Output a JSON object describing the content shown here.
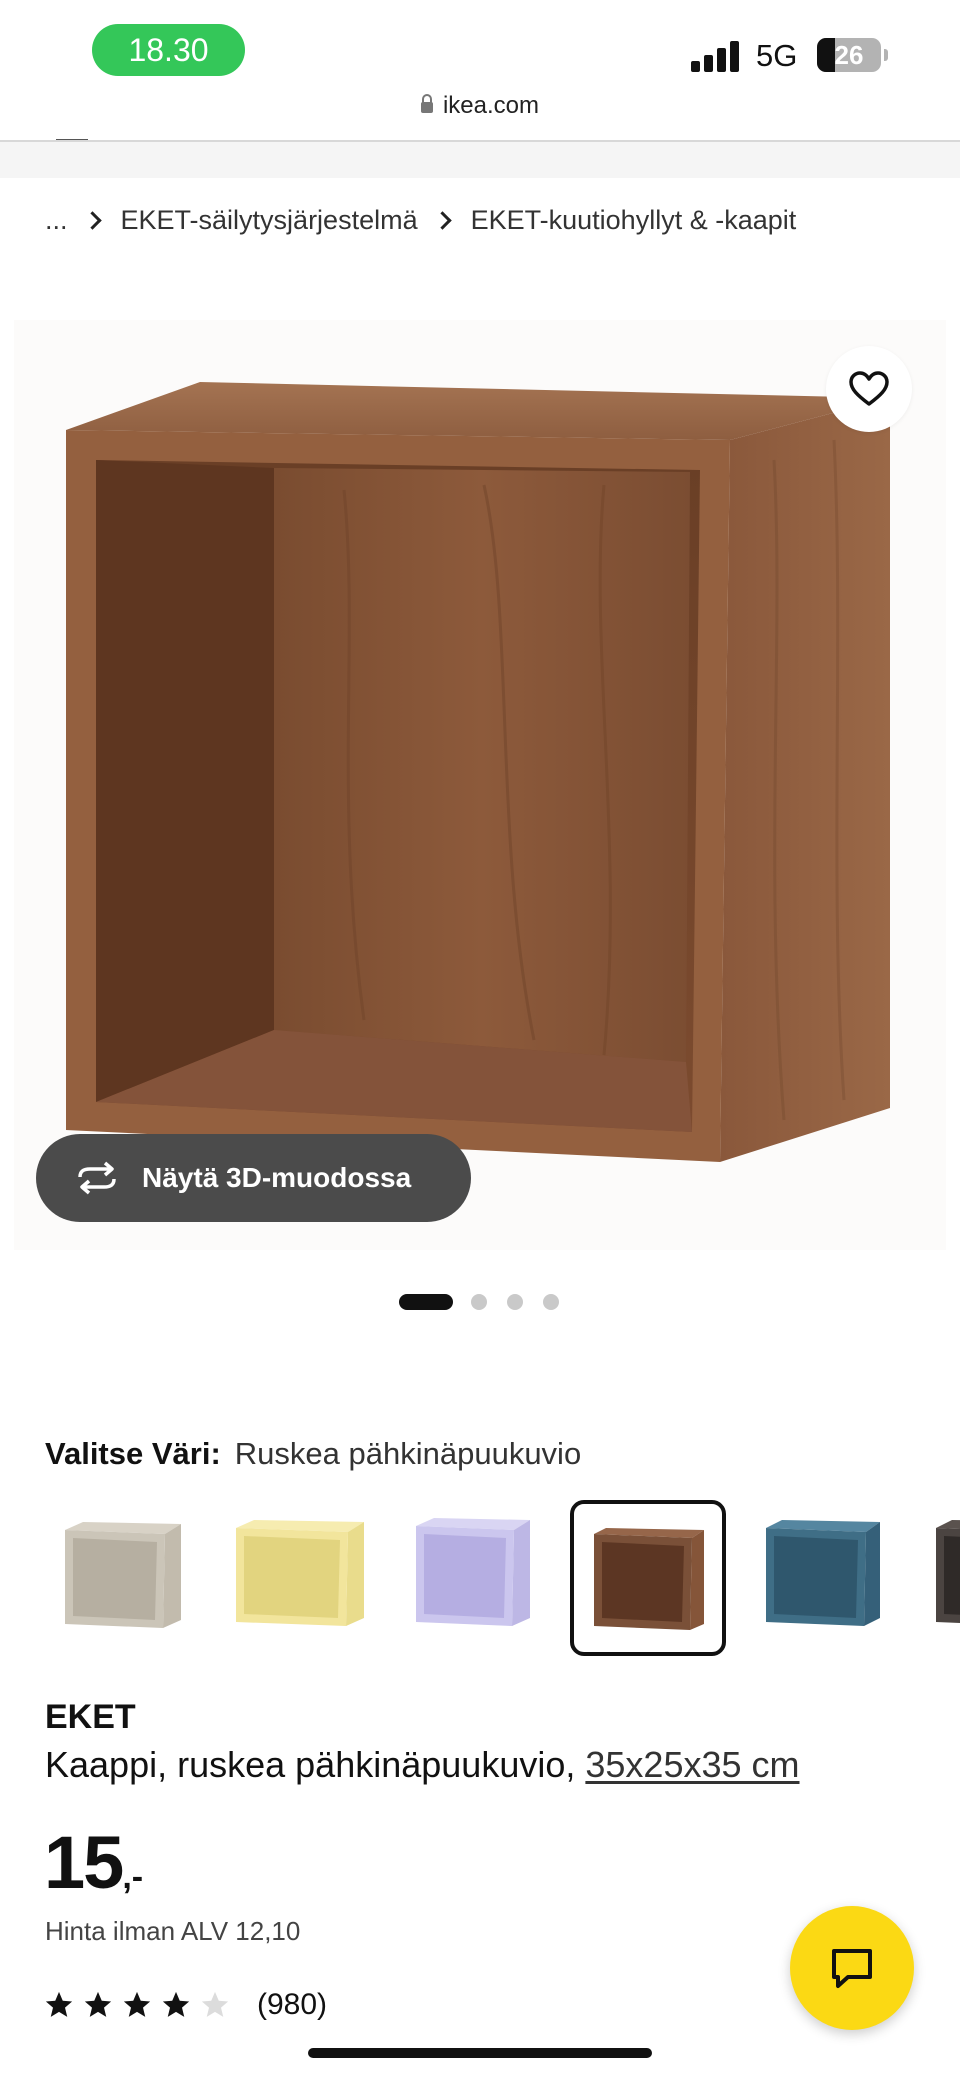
{
  "status_bar": {
    "time": "18.30",
    "network": "5G",
    "battery": "26"
  },
  "browser": {
    "url": "ikea.com"
  },
  "breadcrumb": [
    {
      "label": "..."
    },
    {
      "label": "EKET-säilytysjärjestelmä"
    },
    {
      "label": "EKET-kuutiohyllyt & -kaapit"
    }
  ],
  "gallery": {
    "view_3d_label": "Näytä 3D-muodossa",
    "image_count": 4,
    "current_image": 1
  },
  "color_select": {
    "label": "Valitse Väri:",
    "selected_value": "Ruskea pähkinäpuukuvio",
    "swatches": [
      {
        "name": "beige",
        "color": "#cbc5b8",
        "selected": false
      },
      {
        "name": "yellow",
        "color": "#f2e59c",
        "selected": false
      },
      {
        "name": "lilac",
        "color": "#cbc6ee",
        "selected": false
      },
      {
        "name": "walnut",
        "color": "#7a5038",
        "selected": true
      },
      {
        "name": "blue",
        "color": "#3f6e86",
        "selected": false
      },
      {
        "name": "dark",
        "color": "#4b4441",
        "selected": false
      }
    ]
  },
  "product": {
    "name": "EKET",
    "description": "Kaappi, ruskea pähkinäpuukuvio,",
    "dimensions": "35x25x35 cm",
    "price_main": "15",
    "price_suffix": ",-",
    "vat_note": "Hinta ilman ALV 12,10",
    "rating": 4,
    "rating_max": 5,
    "review_count": "(980)"
  },
  "colors": {
    "chat_button": "#fbd914",
    "accent_green": "#34c759",
    "button_3d": "#4b4b4b"
  },
  "icons": [
    "heart-icon",
    "rotate-3d-icon",
    "chat-icon",
    "star-icon",
    "lock-icon",
    "chevron-right-icon"
  ]
}
